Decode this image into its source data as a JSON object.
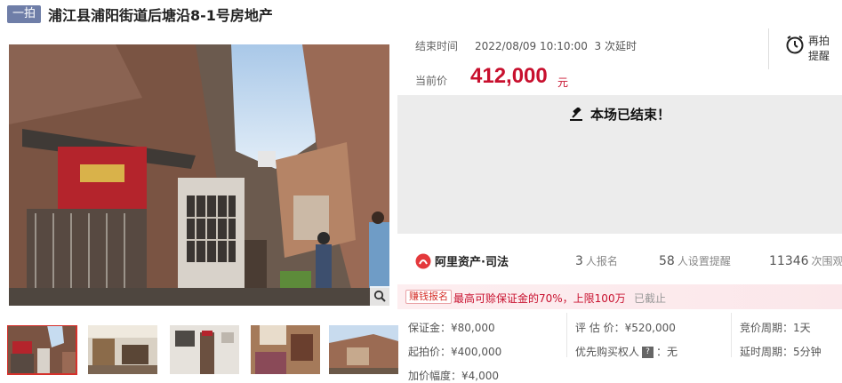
{
  "header": {
    "badge": "一拍",
    "title": "浦江县浦阳街道后塘沿8-1号房地产"
  },
  "auction": {
    "end_label": "结束时间",
    "end_time": "2022/08/09 10:10:00  3 次延时",
    "price_label": "当前价",
    "price_value": "412,000",
    "price_unit": "元",
    "remind_label": "再拍提醒",
    "ended_text": "本场已结束！"
  },
  "platform": {
    "name": "阿里资产·司法"
  },
  "stats": [
    {
      "num": "3",
      "unit": "人报名"
    },
    {
      "num": "58",
      "unit": "人设置提醒"
    },
    {
      "num": "11346",
      "unit": "次围观"
    }
  ],
  "promo": {
    "tag": "赚钱报名",
    "text": "最高可赊保证金的70%，上限100万",
    "status": "已截止"
  },
  "details": {
    "deposit": "保证金：¥80,000",
    "appraisal": "评 估 价：¥520,000",
    "cycle": "竞价周期：1天",
    "start_price": "起拍价：¥400,000",
    "priority_label": "优先购买权人",
    "priority_icon_text": "?",
    "priority_value": "：无",
    "extension": "延时周期：5分钟",
    "increment": "加价幅度：¥4,000"
  },
  "thumbnails": [
    "building-exterior",
    "interior-room",
    "doorway",
    "bedroom",
    "building-rear"
  ],
  "colors": {
    "price_red": "#c8102e",
    "badge_blue": "#6f7ea8",
    "panel_gray": "#ececec",
    "promo_bg": "#fdeef0"
  }
}
